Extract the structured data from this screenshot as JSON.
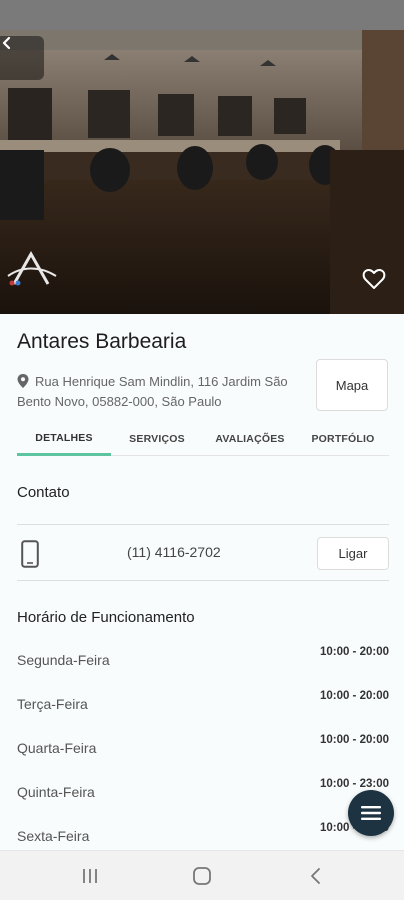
{
  "business": {
    "name": "Antares Barbearia",
    "address": "Rua Henrique Sam Mindlin, 116 Jardim São Bento Novo, 05882-000, São Paulo",
    "map_label": "Mapa"
  },
  "tabs": [
    {
      "label": "DETALHES",
      "active": true
    },
    {
      "label": "SERVIÇOS",
      "active": false
    },
    {
      "label": "AVALIAÇÕES",
      "active": false
    },
    {
      "label": "PORTFÓLIO",
      "active": false
    }
  ],
  "contact": {
    "title": "Contato",
    "phone": "(11) 4116-2702",
    "call_label": "Ligar"
  },
  "hours": {
    "title": "Horário de Funcionamento",
    "rows": [
      {
        "day": "Segunda-Feira",
        "time": "10:00 - 20:00"
      },
      {
        "day": "Terça-Feira",
        "time": "10:00 - 20:00"
      },
      {
        "day": "Quarta-Feira",
        "time": "10:00 - 20:00"
      },
      {
        "day": "Quinta-Feira",
        "time": "10:00 - 23:00"
      },
      {
        "day": "Sexta-Feira",
        "time": "10:00 - 20:00"
      }
    ]
  },
  "icons": {
    "back": "chevron-left-icon",
    "favorite": "heart-outline-icon",
    "location": "map-pin-icon",
    "phone": "smartphone-icon",
    "menu": "menu-icon",
    "nav_recents": "recents-icon",
    "nav_home": "home-icon",
    "nav_back": "back-icon"
  },
  "colors": {
    "accent": "#5cc5a0",
    "fab": "#1e3342",
    "status_bar": "#7a7a7a"
  }
}
